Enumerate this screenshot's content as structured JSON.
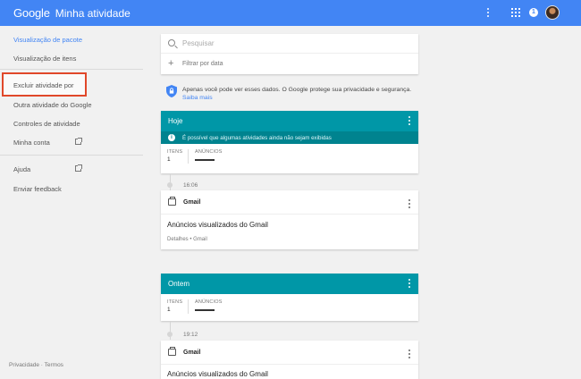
{
  "header": {
    "brand": "Google",
    "title": "Minha atividade",
    "notification_count": "1"
  },
  "sidebar": {
    "items": [
      {
        "label": "Visualização de pacote"
      },
      {
        "label": "Visualização de itens"
      },
      {
        "label": "Excluir atividade por"
      },
      {
        "label": "Outra atividade do Google"
      },
      {
        "label": "Controles de atividade"
      },
      {
        "label": "Minha conta"
      },
      {
        "label": "Ajuda"
      },
      {
        "label": "Enviar feedback"
      }
    ],
    "footer": "Privacidade · Termos"
  },
  "search": {
    "placeholder": "Pesquisar",
    "filter_label": "Filtrar por data"
  },
  "privacy": {
    "text": "Apenas você pode ver esses dados. O Google protege sua privacidade e segurança.",
    "link": "Saiba mais"
  },
  "groups": [
    {
      "title": "Hoje",
      "info": "É possível que algumas atividades ainda não sejam exibidas",
      "items_label": "ITENS",
      "items_count": "1",
      "ads_label": "ANÚNCIOS",
      "entry": {
        "time": "16:06",
        "app": "Gmail",
        "title": "Anúncios visualizados do Gmail",
        "details": "Detalhes • Gmail"
      }
    },
    {
      "title": "Ontem",
      "items_label": "ITENS",
      "items_count": "1",
      "ads_label": "ANÚNCIOS",
      "entry": {
        "time": "19:12",
        "app": "Gmail",
        "title": "Anúncios visualizados do Gmail"
      }
    }
  ],
  "colors": {
    "topbar": "#4285f4",
    "group_header": "#0097a7",
    "info_bar": "#00838f",
    "highlight": "#e0482a"
  }
}
